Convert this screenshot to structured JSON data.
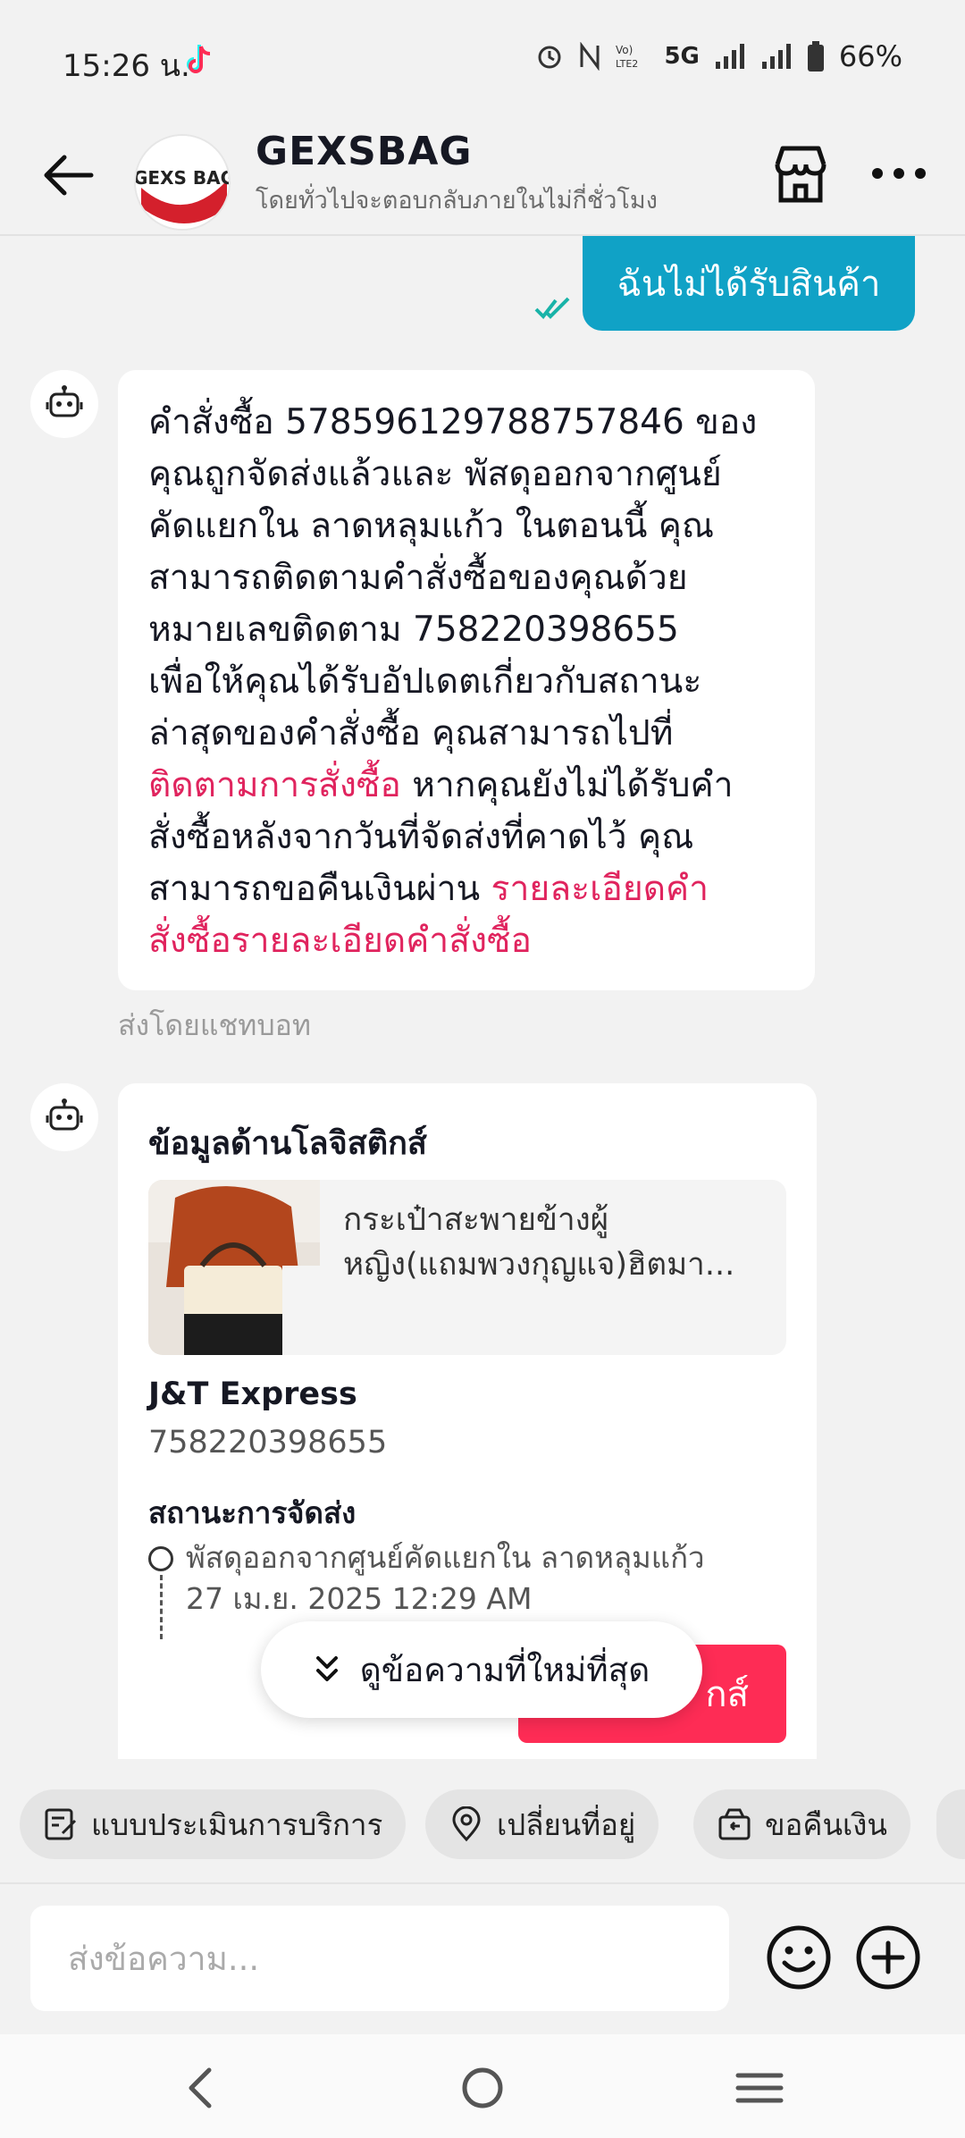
{
  "status_bar": {
    "time": "15:26 น.",
    "network": "5G",
    "battery": "66%"
  },
  "header": {
    "logo_text": "GEXS BAG",
    "shop_name": "GEXSBAG",
    "subtitle": "โดยทั่วไปจะตอบกลับภายในไม่กี่ชั่วโมง"
  },
  "user_message": {
    "text": "ฉันไม่ได้รับสินค้า"
  },
  "bot_message": {
    "line1": "คำสั่งซื้อ 578596129788757846 ของ",
    "line2": "คุณถูกจัดส่งแล้วและ พัสดุออกจากศูนย์",
    "line3": "คัดแยกใน ลาดหลุมแก้ว ในตอนนี้ คุณ",
    "line4": "สามารถติดตามคำสั่งซื้อของคุณด้วย",
    "line5": "หมายเลขติดตาม 758220398655",
    "line6": " เพื่อให้คุณได้รับอัปเดตเกี่ยวกับสถานะ",
    "line7": "ล่าสุดของคำสั่งซื้อ คุณสามารถไปที่",
    "link_track": "ติดตามการสั่งซื้อ",
    "line8_rest": " หากคุณยังไม่ได้รับคำ",
    "line9": "สั่งซื้อหลังจากวันที่จัดส่งที่คาดไว้ คุณ",
    "line10": "สามารถขอคืนเงินผ่าน ",
    "link_details_1": "รายละเอียดคำ",
    "link_details_2": "สั่งซื้อรายละเอียดคำสั่งซื้อ",
    "sent_by": "ส่งโดยแชทบอท"
  },
  "logistics_card": {
    "title": "ข้อมูลด้านโลจิสติกส์",
    "product_name_line1": "กระเป๋าสะพายข้างผู้",
    "product_name_line2": "หญิง(แถมพวงกุญแจ)ฮิตมา...",
    "courier": "J&T Express",
    "tracking_number": "758220398655",
    "status_title": "สถานะการจัดส่ง",
    "event_text": "พัสดุออกจากศูนย์คัดแยกใน ลาดหลุมแก้ว",
    "event_time": "27 เม.ย. 2025 12:29 AM",
    "button_visible_text": "กส์"
  },
  "latest_pill": {
    "label": "ดูข้อความที่ใหม่ที่สุด"
  },
  "quick_actions": [
    {
      "label": "แบบประเมินการบริการ",
      "icon": "survey-icon"
    },
    {
      "label": "เปลี่ยนที่อยู่",
      "icon": "location-pin-icon"
    },
    {
      "label": "ขอคืนเงิน",
      "icon": "refund-icon"
    }
  ],
  "input": {
    "placeholder": "ส่งข้อความ..."
  },
  "colors": {
    "accent_blue": "#10a2c6",
    "accent_red": "#fe2c55",
    "link_red": "#e0245e"
  }
}
